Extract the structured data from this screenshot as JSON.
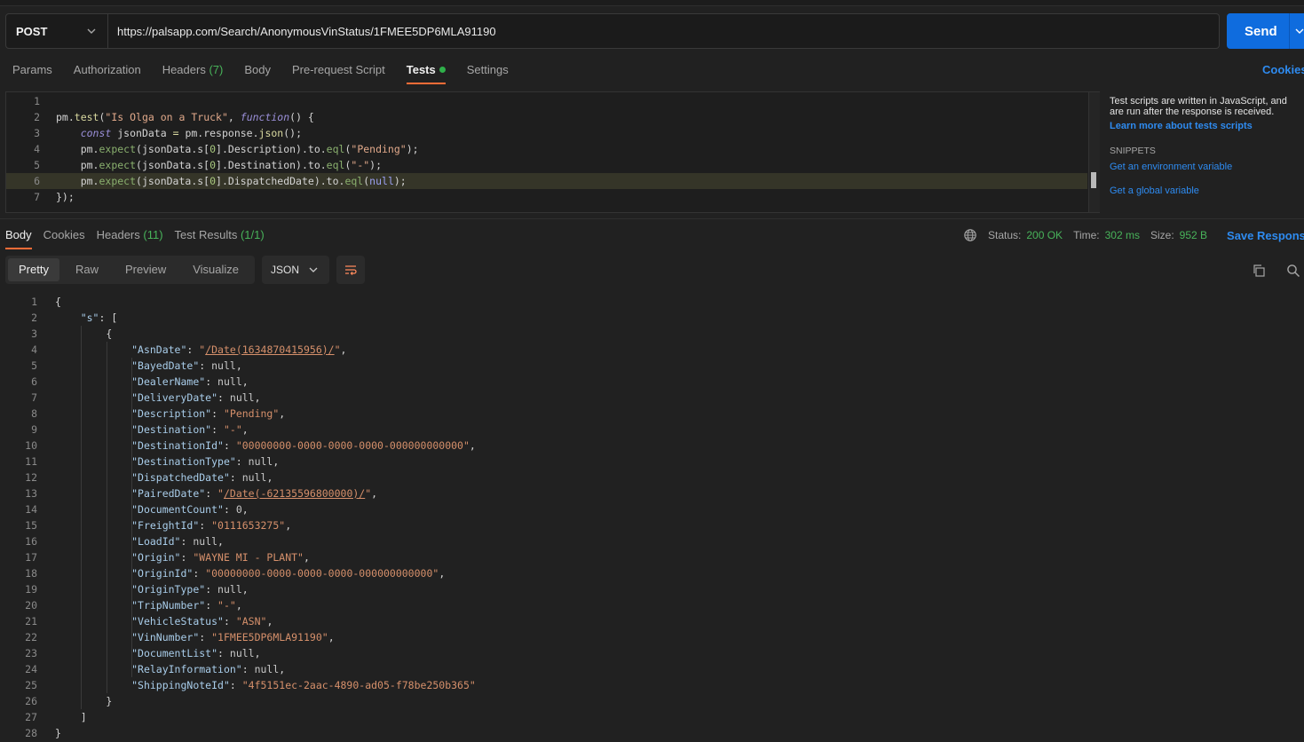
{
  "request": {
    "method": "POST",
    "url": "https://palsapp.com/Search/AnonymousVinStatus/1FMEE5DP6MLA91190",
    "send_label": "Send"
  },
  "req_tabs": {
    "params": "Params",
    "authorization": "Authorization",
    "headers": "Headers",
    "headers_count": "(7)",
    "body": "Body",
    "prerequest": "Pre-request Script",
    "tests": "Tests",
    "settings": "Settings",
    "cookies": "Cookies"
  },
  "editor": {
    "lines": [
      {
        "n": "1",
        "tokens": []
      },
      {
        "n": "2",
        "tokens": [
          [
            "var",
            "pm."
          ],
          [
            "fn",
            "test"
          ],
          [
            "var",
            "("
          ],
          [
            "str",
            "\"Is Olga on a Truck\""
          ],
          [
            "var",
            ", "
          ],
          [
            "kw",
            "function"
          ],
          [
            "var",
            "() {"
          ]
        ]
      },
      {
        "n": "3",
        "tokens": [
          [
            "var",
            "    "
          ],
          [
            "kw",
            "const"
          ],
          [
            "var",
            " jsonData "
          ],
          [
            "fn",
            "="
          ],
          [
            "var",
            " pm.response."
          ],
          [
            "fn",
            "json"
          ],
          [
            "var",
            "();"
          ]
        ]
      },
      {
        "n": "4",
        "tokens": [
          [
            "var",
            "    pm."
          ],
          [
            "meth",
            "expect"
          ],
          [
            "var",
            "(jsonData.s["
          ],
          [
            "num",
            "0"
          ],
          [
            "var",
            "].Description).to."
          ],
          [
            "meth",
            "eql"
          ],
          [
            "var",
            "("
          ],
          [
            "str",
            "\"Pending\""
          ],
          [
            "var",
            ");"
          ]
        ]
      },
      {
        "n": "5",
        "tokens": [
          [
            "var",
            "    pm."
          ],
          [
            "meth",
            "expect"
          ],
          [
            "var",
            "(jsonData.s["
          ],
          [
            "num",
            "0"
          ],
          [
            "var",
            "].Destination).to."
          ],
          [
            "meth",
            "eql"
          ],
          [
            "var",
            "("
          ],
          [
            "str",
            "\"-\""
          ],
          [
            "var",
            ");"
          ]
        ]
      },
      {
        "n": "6",
        "tokens": [
          [
            "var",
            "    pm."
          ],
          [
            "meth",
            "expect"
          ],
          [
            "var",
            "(jsonData.s["
          ],
          [
            "num",
            "0"
          ],
          [
            "var",
            "].DispatchedDate).to."
          ],
          [
            "meth",
            "eql"
          ],
          [
            "var",
            "("
          ],
          [
            "nl",
            "null"
          ],
          [
            "var",
            ");"
          ]
        ],
        "highlight": true
      },
      {
        "n": "7",
        "tokens": [
          [
            "var",
            "});"
          ]
        ]
      }
    ]
  },
  "help": {
    "text": "Test scripts are written in JavaScript, and are run after the response is received.",
    "learn_more": "Learn more about tests scripts",
    "snippets_heading": "SNIPPETS",
    "snippet_1": "Get an environment variable",
    "snippet_2": "Get a global variable"
  },
  "resp_tabs": {
    "body": "Body",
    "cookies": "Cookies",
    "headers": "Headers",
    "headers_count": "(11)",
    "test_results": "Test Results",
    "test_results_count": "(1/1)"
  },
  "status": {
    "status_label": "Status:",
    "status_value": "200 OK",
    "time_label": "Time:",
    "time_value": "302 ms",
    "size_label": "Size:",
    "size_value": "952 B",
    "save_response": "Save Response"
  },
  "view": {
    "pretty": "Pretty",
    "raw": "Raw",
    "preview": "Preview",
    "visualize": "Visualize",
    "format": "JSON"
  },
  "response": {
    "lines": [
      {
        "n": "1",
        "indent": 0,
        "tokens": [
          [
            "var",
            "{"
          ]
        ]
      },
      {
        "n": "2",
        "indent": 1,
        "tokens": [
          [
            "jkey",
            "\"s\""
          ],
          [
            "var",
            ": ["
          ]
        ]
      },
      {
        "n": "3",
        "indent": 2,
        "tokens": [
          [
            "var",
            "{"
          ]
        ]
      },
      {
        "n": "4",
        "indent": 3,
        "tokens": [
          [
            "jkey",
            "\"AsnDate\""
          ],
          [
            "var",
            ": "
          ],
          [
            "jstr",
            "\""
          ],
          [
            "jlink",
            "/Date(1634870415956)/"
          ],
          [
            "jstr",
            "\""
          ],
          [
            "var",
            ","
          ]
        ]
      },
      {
        "n": "5",
        "indent": 3,
        "tokens": [
          [
            "jkey",
            "\"BayedDate\""
          ],
          [
            "var",
            ": "
          ],
          [
            "jnull",
            "null"
          ],
          [
            "var",
            ","
          ]
        ]
      },
      {
        "n": "6",
        "indent": 3,
        "tokens": [
          [
            "jkey",
            "\"DealerName\""
          ],
          [
            "var",
            ": "
          ],
          [
            "jnull",
            "null"
          ],
          [
            "var",
            ","
          ]
        ]
      },
      {
        "n": "7",
        "indent": 3,
        "tokens": [
          [
            "jkey",
            "\"DeliveryDate\""
          ],
          [
            "var",
            ": "
          ],
          [
            "jnull",
            "null"
          ],
          [
            "var",
            ","
          ]
        ]
      },
      {
        "n": "8",
        "indent": 3,
        "tokens": [
          [
            "jkey",
            "\"Description\""
          ],
          [
            "var",
            ": "
          ],
          [
            "jstr",
            "\"Pending\""
          ],
          [
            "var",
            ","
          ]
        ]
      },
      {
        "n": "9",
        "indent": 3,
        "tokens": [
          [
            "jkey",
            "\"Destination\""
          ],
          [
            "var",
            ": "
          ],
          [
            "jstr",
            "\"-\""
          ],
          [
            "var",
            ","
          ]
        ]
      },
      {
        "n": "10",
        "indent": 3,
        "tokens": [
          [
            "jkey",
            "\"DestinationId\""
          ],
          [
            "var",
            ": "
          ],
          [
            "jstr",
            "\"00000000-0000-0000-0000-000000000000\""
          ],
          [
            "var",
            ","
          ]
        ]
      },
      {
        "n": "11",
        "indent": 3,
        "tokens": [
          [
            "jkey",
            "\"DestinationType\""
          ],
          [
            "var",
            ": "
          ],
          [
            "jnull",
            "null"
          ],
          [
            "var",
            ","
          ]
        ]
      },
      {
        "n": "12",
        "indent": 3,
        "tokens": [
          [
            "jkey",
            "\"DispatchedDate\""
          ],
          [
            "var",
            ": "
          ],
          [
            "jnull",
            "null"
          ],
          [
            "var",
            ","
          ]
        ]
      },
      {
        "n": "13",
        "indent": 3,
        "tokens": [
          [
            "jkey",
            "\"PairedDate\""
          ],
          [
            "var",
            ": "
          ],
          [
            "jstr",
            "\""
          ],
          [
            "jlink",
            "/Date(-62135596800000)/"
          ],
          [
            "jstr",
            "\""
          ],
          [
            "var",
            ","
          ]
        ]
      },
      {
        "n": "14",
        "indent": 3,
        "tokens": [
          [
            "jkey",
            "\"DocumentCount\""
          ],
          [
            "var",
            ": "
          ],
          [
            "jnum",
            "0"
          ],
          [
            "var",
            ","
          ]
        ]
      },
      {
        "n": "15",
        "indent": 3,
        "tokens": [
          [
            "jkey",
            "\"FreightId\""
          ],
          [
            "var",
            ": "
          ],
          [
            "jstr",
            "\"0111653275\""
          ],
          [
            "var",
            ","
          ]
        ]
      },
      {
        "n": "16",
        "indent": 3,
        "tokens": [
          [
            "jkey",
            "\"LoadId\""
          ],
          [
            "var",
            ": "
          ],
          [
            "jnull",
            "null"
          ],
          [
            "var",
            ","
          ]
        ]
      },
      {
        "n": "17",
        "indent": 3,
        "tokens": [
          [
            "jkey",
            "\"Origin\""
          ],
          [
            "var",
            ": "
          ],
          [
            "jstr",
            "\"WAYNE MI - PLANT\""
          ],
          [
            "var",
            ","
          ]
        ]
      },
      {
        "n": "18",
        "indent": 3,
        "tokens": [
          [
            "jkey",
            "\"OriginId\""
          ],
          [
            "var",
            ": "
          ],
          [
            "jstr",
            "\"00000000-0000-0000-0000-000000000000\""
          ],
          [
            "var",
            ","
          ]
        ]
      },
      {
        "n": "19",
        "indent": 3,
        "tokens": [
          [
            "jkey",
            "\"OriginType\""
          ],
          [
            "var",
            ": "
          ],
          [
            "jnull",
            "null"
          ],
          [
            "var",
            ","
          ]
        ]
      },
      {
        "n": "20",
        "indent": 3,
        "tokens": [
          [
            "jkey",
            "\"TripNumber\""
          ],
          [
            "var",
            ": "
          ],
          [
            "jstr",
            "\"-\""
          ],
          [
            "var",
            ","
          ]
        ]
      },
      {
        "n": "21",
        "indent": 3,
        "tokens": [
          [
            "jkey",
            "\"VehicleStatus\""
          ],
          [
            "var",
            ": "
          ],
          [
            "jstr",
            "\"ASN\""
          ],
          [
            "var",
            ","
          ]
        ]
      },
      {
        "n": "22",
        "indent": 3,
        "tokens": [
          [
            "jkey",
            "\"VinNumber\""
          ],
          [
            "var",
            ": "
          ],
          [
            "jstr",
            "\"1FMEE5DP6MLA91190\""
          ],
          [
            "var",
            ","
          ]
        ]
      },
      {
        "n": "23",
        "indent": 3,
        "tokens": [
          [
            "jkey",
            "\"DocumentList\""
          ],
          [
            "var",
            ": "
          ],
          [
            "jnull",
            "null"
          ],
          [
            "var",
            ","
          ]
        ]
      },
      {
        "n": "24",
        "indent": 3,
        "tokens": [
          [
            "jkey",
            "\"RelayInformation\""
          ],
          [
            "var",
            ": "
          ],
          [
            "jnull",
            "null"
          ],
          [
            "var",
            ","
          ]
        ]
      },
      {
        "n": "25",
        "indent": 3,
        "tokens": [
          [
            "jkey",
            "\"ShippingNoteId\""
          ],
          [
            "var",
            ": "
          ],
          [
            "jstr",
            "\"4f5151ec-2aac-4890-ad05-f78be250b365\""
          ]
        ]
      },
      {
        "n": "26",
        "indent": 2,
        "tokens": [
          [
            "var",
            "}"
          ]
        ]
      },
      {
        "n": "27",
        "indent": 1,
        "tokens": [
          [
            "var",
            "]"
          ]
        ]
      },
      {
        "n": "28",
        "indent": 0,
        "tokens": [
          [
            "var",
            "}"
          ]
        ]
      }
    ]
  },
  "colors": {
    "accent_blue": "#0f6cde",
    "tab_underline": "#ff6c37",
    "success_green": "#48b35a"
  }
}
